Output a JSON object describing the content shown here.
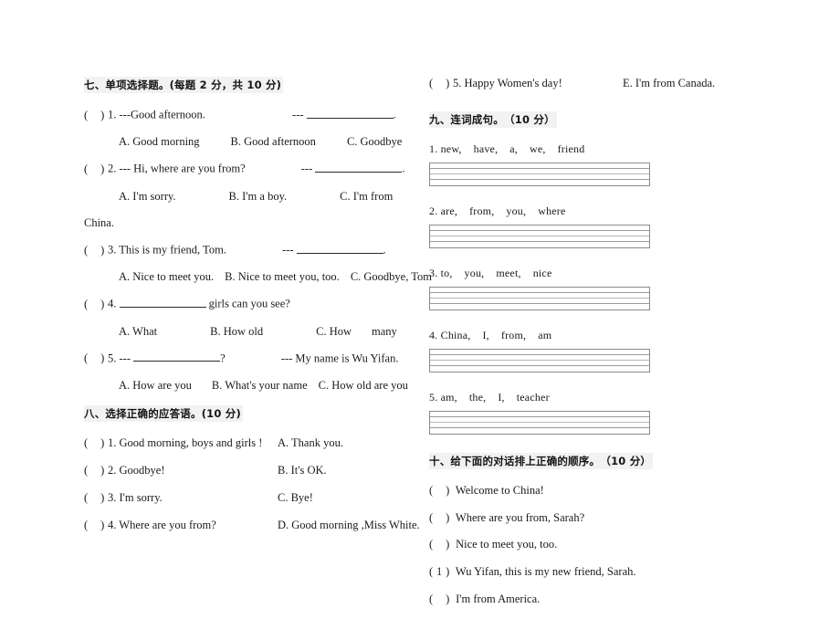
{
  "sections": {
    "seven": {
      "heading": "七、单项选择题。(每题 2 分，共 10 分)",
      "items": [
        {
          "num": "1.",
          "stem": "---Good afternoon.",
          "dash": "---",
          "tail": ".",
          "options": [
            "A. Good morning",
            "B. Good afternoon",
            "C. Goodbye"
          ]
        },
        {
          "num": "2.",
          "stem": "--- Hi, where are you from?",
          "dash": "---",
          "tail": ".",
          "options": [
            "A. I'm sorry.",
            "B. I'm a boy.",
            "C. I'm from",
            "China."
          ]
        },
        {
          "num": "3.",
          "stem": "This is my friend, Tom.",
          "dash": "---",
          "tail": ".",
          "options": [
            "A. Nice to meet you.",
            "B. Nice to meet you, too.",
            "C. Goodbye, Tom"
          ]
        },
        {
          "num": "4.",
          "stem_after": "girls can you see?",
          "options": [
            "A. What",
            "B. How old",
            "C. How",
            "many"
          ]
        },
        {
          "num": "5.",
          "lead": "---",
          "tail": "?",
          "answer": "--- My name is Wu Yifan.",
          "options": [
            "A. How are you",
            "B. What's your name",
            "C. How old are you"
          ]
        }
      ]
    },
    "eight": {
      "heading": "八、选择正确的应答语。(10 分)",
      "items": [
        {
          "num": "1.",
          "left": "Good morning, boys and girls !",
          "right": "A. Thank you."
        },
        {
          "num": "2.",
          "left": "Goodbye!",
          "right": "B. It's OK."
        },
        {
          "num": "3.",
          "left": "I'm sorry.",
          "right": "C. Bye!"
        },
        {
          "num": "4.",
          "left": "Where are you from?",
          "right": "D. Good morning ,Miss White."
        },
        {
          "num": "5.",
          "left": "Happy Women's day!",
          "right": "E. I'm from Canada."
        }
      ]
    },
    "nine": {
      "heading": "九、连词成句。　（10 分）",
      "items": [
        {
          "num": "1.",
          "words": [
            "new,",
            "have,",
            "a,",
            "we,",
            "friend"
          ]
        },
        {
          "num": "2.",
          "words": [
            "are,",
            "from,",
            "you,",
            "where"
          ]
        },
        {
          "num": "3.",
          "words": [
            "to,",
            "you,",
            "meet,",
            "nice"
          ]
        },
        {
          "num": "4.",
          "words": [
            "China,",
            "I,",
            "from,",
            "am"
          ]
        },
        {
          "num": "5.",
          "words": [
            "am,",
            "the,",
            "I,",
            "teacher"
          ]
        }
      ]
    },
    "ten": {
      "heading": "十、给下面的对话排上正确的顺序。　（10 分）",
      "items": [
        {
          "mark": "",
          "text": "Welcome to China!"
        },
        {
          "mark": "",
          "text": "Where are you from, Sarah?"
        },
        {
          "mark": "",
          "text": "Nice to meet you, too."
        },
        {
          "mark": "1",
          "text": "Wu Yifan, this is my new friend, Sarah."
        },
        {
          "mark": "",
          "text": "I'm from America."
        }
      ]
    }
  }
}
